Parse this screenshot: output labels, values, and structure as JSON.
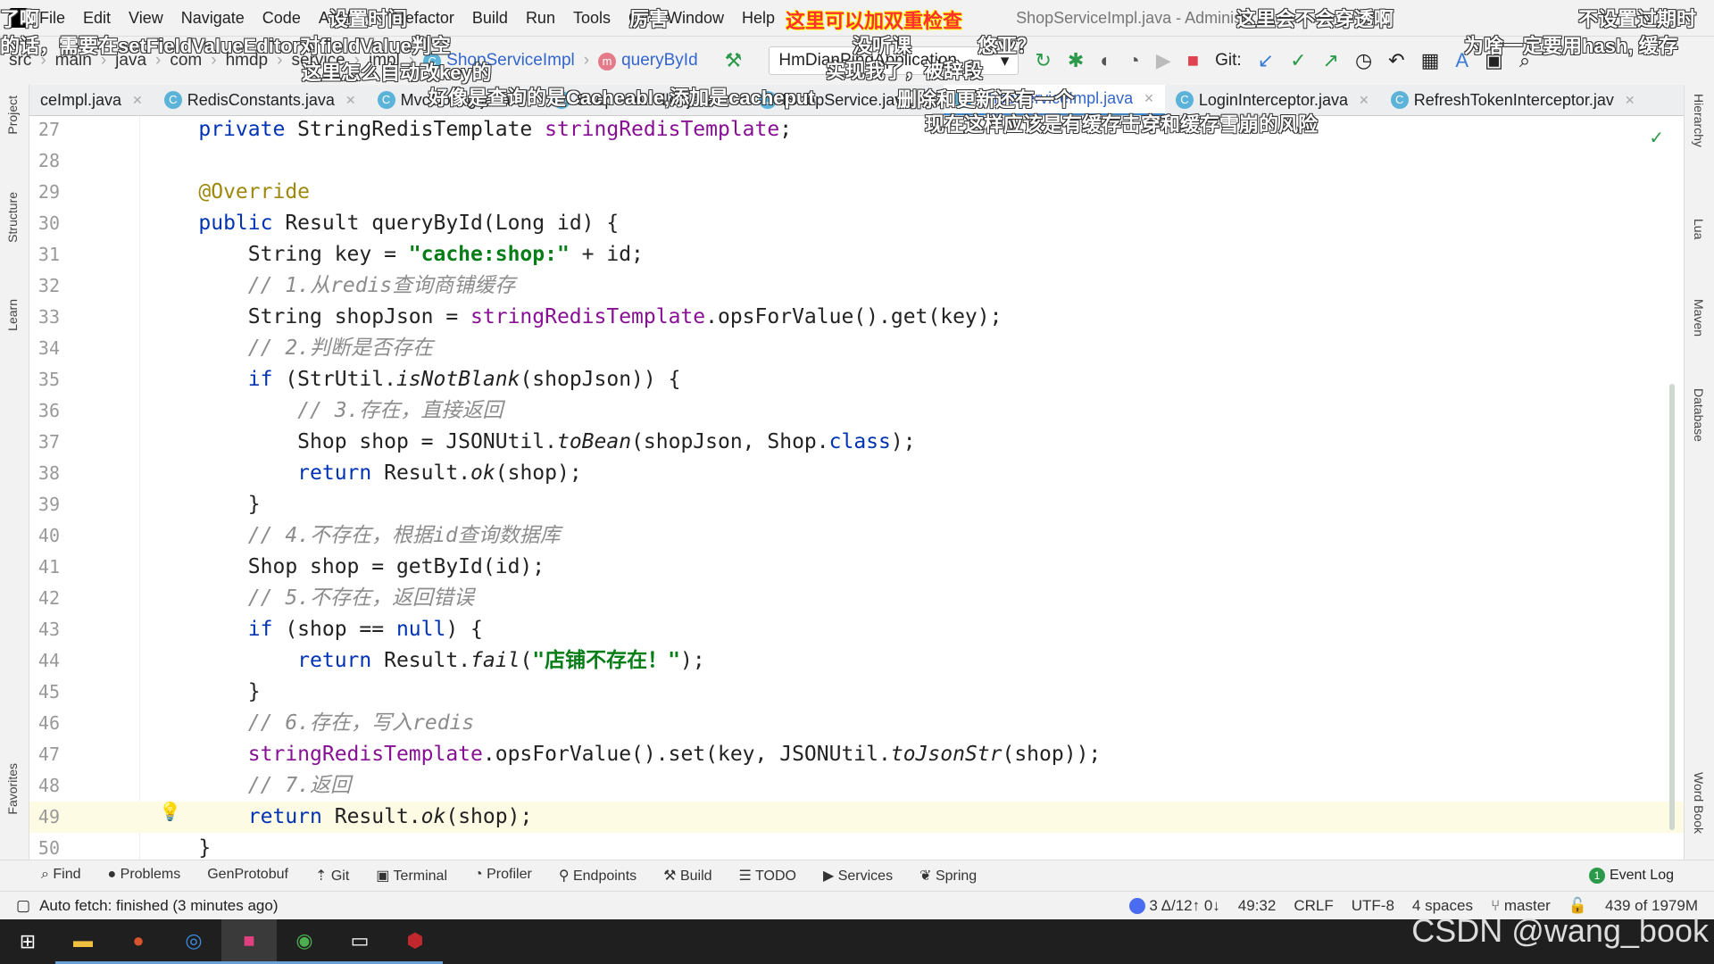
{
  "menu": {
    "items": [
      "File",
      "Edit",
      "View",
      "Navigate",
      "Code",
      "Analyze",
      "Refactor",
      "Build",
      "Run",
      "Tools",
      "Git",
      "Window",
      "Help"
    ],
    "window_title": "ShopServiceImpl.java - Administr"
  },
  "breadcrumb": [
    "src",
    "main",
    "java",
    "com",
    "hmdp",
    "service",
    "impl"
  ],
  "breadcrumb_class": "ShopServiceImpl",
  "breadcrumb_method": "queryById",
  "run_config": "HmDianPingApplication",
  "git_label": "Git:",
  "tabs": [
    {
      "label": "ceImpl.java",
      "active": false
    },
    {
      "label": "RedisConstants.java",
      "active": false
    },
    {
      "label": "MvcConfig.java",
      "active": false
    },
    {
      "label": "ShopController.java",
      "active": false
    },
    {
      "label": "IShopService.java",
      "active": false
    },
    {
      "label": "ShopServiceImpl.java",
      "active": true
    },
    {
      "label": "LoginInterceptor.java",
      "active": false
    },
    {
      "label": "RefreshTokenInterceptor.jav",
      "active": false
    }
  ],
  "left_tools": [
    "Project",
    "Structure",
    "Learn",
    "Favorites"
  ],
  "right_tools": [
    "Hierarchy",
    "Lua",
    "Maven",
    "Database",
    "Word Book"
  ],
  "code": {
    "current_line": 49,
    "lines": [
      {
        "n": 27,
        "t": [
          [
            "",
            "    "
          ],
          [
            "kw",
            "private "
          ],
          [
            "",
            "StringRedisTemplate "
          ],
          [
            "fld",
            "stringRedisTemplate"
          ],
          [
            "",
            ";"
          ]
        ]
      },
      {
        "n": 28,
        "t": []
      },
      {
        "n": 29,
        "t": [
          [
            "",
            "    "
          ],
          [
            "ann",
            "@Override"
          ]
        ]
      },
      {
        "n": 30,
        "t": [
          [
            "",
            "    "
          ],
          [
            "kw",
            "public "
          ],
          [
            "",
            "Result queryById(Long id) {"
          ]
        ]
      },
      {
        "n": 31,
        "t": [
          [
            "",
            "        String key = "
          ],
          [
            "str",
            "\"cache:shop:\""
          ],
          [
            "",
            " + id;"
          ]
        ]
      },
      {
        "n": 32,
        "t": [
          [
            "",
            "        "
          ],
          [
            "cmt",
            "// 1.从redis查询商铺缓存"
          ]
        ]
      },
      {
        "n": 33,
        "t": [
          [
            "",
            "        String shopJson = "
          ],
          [
            "fld",
            "stringRedisTemplate"
          ],
          [
            "",
            ".opsForValue().get(key);"
          ]
        ]
      },
      {
        "n": 34,
        "t": [
          [
            "",
            "        "
          ],
          [
            "cmt",
            "// 2.判断是否存在"
          ]
        ]
      },
      {
        "n": 35,
        "t": [
          [
            "",
            "        "
          ],
          [
            "kw",
            "if "
          ],
          [
            "",
            "(StrUtil."
          ],
          [
            "it",
            "isNotBlank"
          ],
          [
            "",
            "(shopJson)) {"
          ]
        ]
      },
      {
        "n": 36,
        "t": [
          [
            "",
            "            "
          ],
          [
            "cmt",
            "// 3.存在，直接返回"
          ]
        ]
      },
      {
        "n": 37,
        "t": [
          [
            "",
            "            Shop shop = JSONUtil."
          ],
          [
            "it",
            "toBean"
          ],
          [
            "",
            "(shopJson, Shop."
          ],
          [
            "kw",
            "class"
          ],
          [
            "",
            ");"
          ]
        ]
      },
      {
        "n": 38,
        "t": [
          [
            "",
            "            "
          ],
          [
            "kw",
            "return "
          ],
          [
            "",
            "Result."
          ],
          [
            "it",
            "ok"
          ],
          [
            "",
            "(shop);"
          ]
        ]
      },
      {
        "n": 39,
        "t": [
          [
            "",
            "        }"
          ]
        ]
      },
      {
        "n": 40,
        "t": [
          [
            "",
            "        "
          ],
          [
            "cmt",
            "// 4.不存在，根据id查询数据库"
          ]
        ]
      },
      {
        "n": 41,
        "t": [
          [
            "",
            "        Shop shop = getById(id);"
          ]
        ]
      },
      {
        "n": 42,
        "t": [
          [
            "",
            "        "
          ],
          [
            "cmt",
            "// 5.不存在，返回错误"
          ]
        ]
      },
      {
        "n": 43,
        "t": [
          [
            "",
            "        "
          ],
          [
            "kw",
            "if "
          ],
          [
            "",
            "(shop == "
          ],
          [
            "kw",
            "null"
          ],
          [
            "",
            ") {"
          ]
        ]
      },
      {
        "n": 44,
        "t": [
          [
            "",
            "            "
          ],
          [
            "kw",
            "return "
          ],
          [
            "",
            "Result."
          ],
          [
            "it",
            "fail"
          ],
          [
            "",
            "("
          ],
          [
            "str",
            "\"店铺不存在！\""
          ],
          [
            "",
            ");"
          ]
        ]
      },
      {
        "n": 45,
        "t": [
          [
            "",
            "        }"
          ]
        ]
      },
      {
        "n": 46,
        "t": [
          [
            "",
            "        "
          ],
          [
            "cmt",
            "// 6.存在，写入redis"
          ]
        ]
      },
      {
        "n": 47,
        "t": [
          [
            "",
            "        "
          ],
          [
            "fld",
            "stringRedisTemplate"
          ],
          [
            "",
            ".opsForValue().set(key, JSONUtil."
          ],
          [
            "it",
            "toJsonStr"
          ],
          [
            "",
            "(shop));"
          ]
        ]
      },
      {
        "n": 48,
        "t": [
          [
            "",
            "        "
          ],
          [
            "cmt",
            "// 7.返回"
          ]
        ]
      },
      {
        "n": 49,
        "t": [
          [
            "",
            "        "
          ],
          [
            "kw",
            "return "
          ],
          [
            "",
            "Result."
          ],
          [
            "it",
            "ok"
          ],
          [
            "",
            "(shop);"
          ]
        ]
      },
      {
        "n": 50,
        "t": [
          [
            "",
            "    }"
          ]
        ]
      }
    ]
  },
  "tool_windows": [
    "Find",
    "Problems",
    "GenProtobuf",
    "Git",
    "Terminal",
    "Profiler",
    "Endpoints",
    "Build",
    "TODO",
    "Services",
    "Spring"
  ],
  "event_log": "Event Log",
  "event_count": "1",
  "status": {
    "message": "Auto fetch: finished (3 minutes ago)",
    "git_changes": "3 Δ/12↑ 0↓",
    "position": "49:32",
    "line_sep": "CRLF",
    "encoding": "UTF-8",
    "indent": "4 spaces",
    "branch": "master",
    "memory": "439 of 1979M"
  },
  "watermark": "CSDN @wang_book",
  "danmaku": [
    {
      "text": "这里可以加双重检查",
      "hl": true
    },
    {
      "text": "设置时间"
    },
    {
      "text": "厉害"
    },
    {
      "text": "这里会不会穿透啊"
    },
    {
      "text": "不设置过期时"
    },
    {
      "text": "的话，需要在setFieldValueEditor对fieldValue判空"
    },
    {
      "text": "没听课"
    },
    {
      "text": "悠亚？"
    },
    {
      "text": "为啥一定要用hash, 缓存"
    },
    {
      "text": "这里怎么自动改key的"
    },
    {
      "text": "实现我了，被辞段"
    },
    {
      "text": "好像是查询的是Cacheable,添加是cacheput"
    },
    {
      "text": "删除和更新还有一个"
    },
    {
      "text": "现在这样应该是有缓存击穿和缓存雪崩的风险"
    },
    {
      "text": "了啊"
    }
  ],
  "colors": {
    "accent": "#4083c9",
    "keyword": "#0033b3",
    "string": "#067d17",
    "field": "#871094",
    "comment": "#8c8c8c"
  }
}
